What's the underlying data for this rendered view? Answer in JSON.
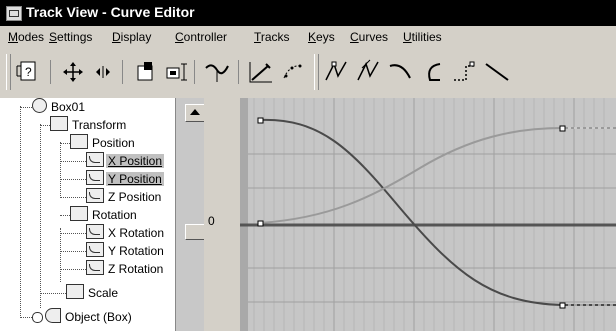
{
  "window": {
    "title": "Track View - Curve Editor"
  },
  "menu": [
    {
      "pre": "",
      "u": "M",
      "post": "odes"
    },
    {
      "pre": "",
      "u": "S",
      "post": "ettings"
    },
    {
      "pre": "",
      "u": "D",
      "post": "isplay"
    },
    {
      "pre": "",
      "u": "C",
      "post": "ontroller"
    },
    {
      "pre": "",
      "u": "T",
      "post": "racks"
    },
    {
      "pre": "",
      "u": "K",
      "post": "eys"
    },
    {
      "pre": "",
      "u": "C",
      "post": "urves"
    },
    {
      "pre": "",
      "u": "U",
      "post": "tilities"
    }
  ],
  "toolbar_icons": [
    "filter-icon",
    "move-keys-icon",
    "slide-keys-icon",
    "scale-keys-icon",
    "scale-values-icon",
    "add-keys-icon",
    "draw-curves-icon",
    "reduce-keys-icon",
    "tangent-auto-icon",
    "tangent-custom-icon",
    "tangent-fast-icon",
    "tangent-slow-icon",
    "tangent-step-icon",
    "tangent-linear-icon"
  ],
  "tree": {
    "box": "Box01",
    "transform": "Transform",
    "position": "Position",
    "x_position": "X Position",
    "y_position": "Y Position",
    "z_position": "Z Position",
    "rotation": "Rotation",
    "x_rotation": "X Rotation",
    "y_rotation": "Y Rotation",
    "z_rotation": "Z Rotation",
    "scale": "Scale",
    "object": "Object (Box)"
  },
  "ruler": {
    "zero_label": "0"
  },
  "curves": {
    "x_position_color": "#4a4a4a",
    "y_position_color": "#9a9a9a",
    "zero_line_color": "#555555"
  }
}
